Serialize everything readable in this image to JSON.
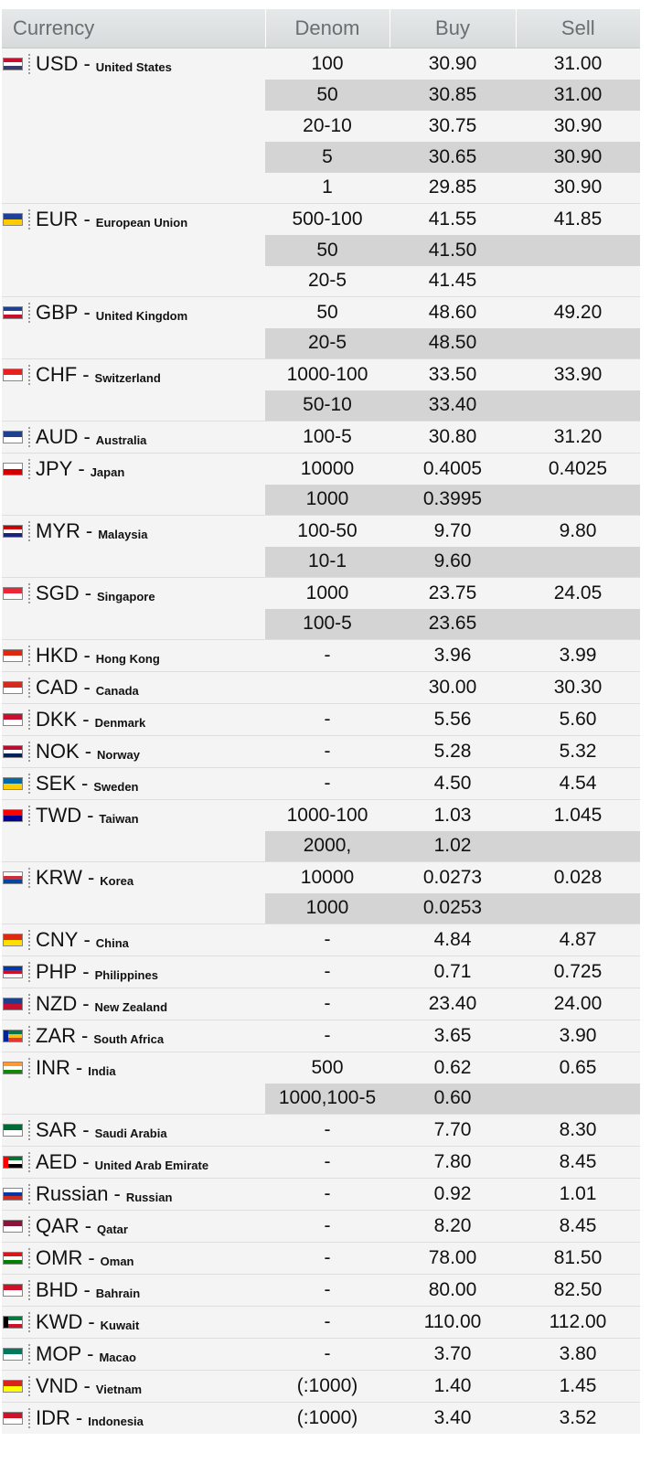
{
  "headers": {
    "currency": "Currency",
    "denom": "Denom",
    "buy": "Buy",
    "sell": "Sell"
  },
  "currencies": [
    {
      "code": "USD",
      "country": "United States",
      "flag": "us-flag",
      "colors": [
        "#c8102e",
        "#ffffff",
        "#3c3b6e"
      ],
      "rows": [
        {
          "denom": "100",
          "buy": "30.90",
          "sell": "31.00"
        },
        {
          "denom": "50",
          "buy": "30.85",
          "sell": "31.00"
        },
        {
          "denom": "20-10",
          "buy": "30.75",
          "sell": "30.90"
        },
        {
          "denom": "5",
          "buy": "30.65",
          "sell": "30.90"
        },
        {
          "denom": "1",
          "buy": "29.85",
          "sell": "30.90"
        }
      ]
    },
    {
      "code": "EUR",
      "country": "European Union",
      "flag": "eu-flag",
      "colors": [
        "#1f3f9f",
        "#ffcc00"
      ],
      "rows": [
        {
          "denom": "500-100",
          "buy": "41.55",
          "sell": "41.85"
        },
        {
          "denom": "50",
          "buy": "41.50",
          "sell": ""
        },
        {
          "denom": "20-5",
          "buy": "41.45",
          "sell": ""
        }
      ]
    },
    {
      "code": "GBP",
      "country": "United Kingdom",
      "flag": "uk-flag",
      "colors": [
        "#1f3f8f",
        "#ffffff",
        "#c8102e"
      ],
      "rows": [
        {
          "denom": "50",
          "buy": "48.60",
          "sell": "49.20"
        },
        {
          "denom": "20-5",
          "buy": "48.50",
          "sell": ""
        }
      ]
    },
    {
      "code": "CHF",
      "country": "Switzerland",
      "flag": "swiss-flag",
      "colors": [
        "#e8201e",
        "#ffffff"
      ],
      "rows": [
        {
          "denom": "1000-100",
          "buy": "33.50",
          "sell": "33.90"
        },
        {
          "denom": "50-10",
          "buy": "33.40",
          "sell": ""
        }
      ]
    },
    {
      "code": "AUD",
      "country": "Australia",
      "flag": "au-flag",
      "colors": [
        "#1f3f8f",
        "#ffffff"
      ],
      "rows": [
        {
          "denom": "100-5",
          "buy": "30.80",
          "sell": "31.20"
        }
      ]
    },
    {
      "code": "JPY",
      "country": "Japan",
      "flag": "jp-flag",
      "colors": [
        "#ffffff",
        "#d40000"
      ],
      "rows": [
        {
          "denom": "10000",
          "buy": "0.4005",
          "sell": "0.4025"
        },
        {
          "denom": "1000",
          "buy": "0.3995",
          "sell": ""
        }
      ]
    },
    {
      "code": "MYR",
      "country": "Malaysia",
      "flag": "my-flag",
      "colors": [
        "#cc0000",
        "#ffffff",
        "#1a237e"
      ],
      "rows": [
        {
          "denom": "100-50",
          "buy": "9.70",
          "sell": "9.80"
        },
        {
          "denom": "10-1",
          "buy": "9.60",
          "sell": ""
        }
      ]
    },
    {
      "code": "SGD",
      "country": "Singapore",
      "flag": "sg-flag",
      "colors": [
        "#ee2536",
        "#ffffff"
      ],
      "rows": [
        {
          "denom": "1000",
          "buy": "23.75",
          "sell": "24.05"
        },
        {
          "denom": "100-5",
          "buy": "23.65",
          "sell": ""
        }
      ]
    },
    {
      "code": "HKD",
      "country": "Hong Kong",
      "flag": "hk-flag",
      "colors": [
        "#de2910",
        "#ffffff"
      ],
      "rows": [
        {
          "denom": "-",
          "buy": "3.96",
          "sell": "3.99"
        }
      ]
    },
    {
      "code": "CAD",
      "country": "Canada",
      "flag": "ca-flag",
      "colors": [
        "#d52b1e",
        "#ffffff"
      ],
      "rows": [
        {
          "denom": "",
          "buy": "30.00",
          "sell": "30.30"
        }
      ]
    },
    {
      "code": "DKK",
      "country": "Denmark",
      "flag": "dk-flag",
      "colors": [
        "#c8102e",
        "#ffffff"
      ],
      "rows": [
        {
          "denom": "-",
          "buy": "5.56",
          "sell": "5.60"
        }
      ]
    },
    {
      "code": "NOK",
      "country": "Norway",
      "flag": "no-flag",
      "colors": [
        "#ba0c2f",
        "#ffffff",
        "#00205b"
      ],
      "rows": [
        {
          "denom": "-",
          "buy": "5.28",
          "sell": "5.32"
        }
      ]
    },
    {
      "code": "SEK",
      "country": "Sweden",
      "flag": "se-flag",
      "colors": [
        "#006aa7",
        "#fecc00"
      ],
      "rows": [
        {
          "denom": "-",
          "buy": "4.50",
          "sell": "4.54"
        }
      ]
    },
    {
      "code": "TWD",
      "country": "Taiwan",
      "flag": "tw-flag",
      "colors": [
        "#fe0000",
        "#000095"
      ],
      "rows": [
        {
          "denom": "1000-100",
          "buy": "1.03",
          "sell": "1.045"
        },
        {
          "denom": "2000,",
          "buy": "1.02",
          "sell": ""
        }
      ]
    },
    {
      "code": "KRW",
      "country": "Korea",
      "flag": "kr-flag",
      "colors": [
        "#ffffff",
        "#cd2e3a",
        "#0047a0"
      ],
      "rows": [
        {
          "denom": "10000",
          "buy": "0.0273",
          "sell": "0.028"
        },
        {
          "denom": "1000",
          "buy": "0.0253",
          "sell": ""
        }
      ]
    },
    {
      "code": "CNY",
      "country": "China",
      "flag": "cn-flag",
      "colors": [
        "#de2910",
        "#ffde00"
      ],
      "rows": [
        {
          "denom": "-",
          "buy": "4.84",
          "sell": "4.87"
        }
      ]
    },
    {
      "code": "PHP",
      "country": "Philippines",
      "flag": "ph-flag",
      "colors": [
        "#0038a8",
        "#ce1126",
        "#ffffff"
      ],
      "rows": [
        {
          "denom": "-",
          "buy": "0.71",
          "sell": "0.725"
        }
      ]
    },
    {
      "code": "NZD",
      "country": "New Zealand",
      "flag": "nz-flag",
      "colors": [
        "#1f3f8f",
        "#c8102e"
      ],
      "rows": [
        {
          "denom": "-",
          "buy": "23.40",
          "sell": "24.00"
        }
      ]
    },
    {
      "code": "ZAR",
      "country": "South Africa",
      "flag": "za-flag",
      "colors": [
        "#007749",
        "#ffb81c",
        "#de3831",
        "#002395"
      ],
      "rows": [
        {
          "denom": "-",
          "buy": "3.65",
          "sell": "3.90"
        }
      ]
    },
    {
      "code": "INR",
      "country": "India",
      "flag": "in-flag",
      "colors": [
        "#ff9933",
        "#ffffff",
        "#138808"
      ],
      "rows": [
        {
          "denom": "500",
          "buy": "0.62",
          "sell": "0.65"
        },
        {
          "denom": "1000,100-5",
          "buy": "0.60",
          "sell": ""
        }
      ]
    },
    {
      "code": "SAR",
      "country": "Saudi Arabia",
      "flag": "sa-flag",
      "colors": [
        "#006c35",
        "#ffffff"
      ],
      "rows": [
        {
          "denom": "-",
          "buy": "7.70",
          "sell": "8.30"
        }
      ]
    },
    {
      "code": "AED",
      "country": "United Arab Emirate",
      "flag": "ae-flag",
      "colors": [
        "#00732f",
        "#ffffff",
        "#000000",
        "#ff0000"
      ],
      "rows": [
        {
          "denom": "-",
          "buy": "7.80",
          "sell": "8.45"
        }
      ]
    },
    {
      "code": "Russian",
      "country": "Russian",
      "flag": "ru-flag",
      "colors": [
        "#ffffff",
        "#0039a6",
        "#d52b1e"
      ],
      "rows": [
        {
          "denom": "-",
          "buy": "0.92",
          "sell": "1.01"
        }
      ]
    },
    {
      "code": "QAR",
      "country": "Qatar",
      "flag": "qa-flag",
      "colors": [
        "#8a1538",
        "#ffffff"
      ],
      "rows": [
        {
          "denom": "-",
          "buy": "8.20",
          "sell": "8.45"
        }
      ]
    },
    {
      "code": "OMR",
      "country": "Oman",
      "flag": "om-flag",
      "colors": [
        "#db161b",
        "#ffffff",
        "#008000"
      ],
      "rows": [
        {
          "denom": "-",
          "buy": "78.00",
          "sell": "81.50"
        }
      ]
    },
    {
      "code": "BHD",
      "country": "Bahrain",
      "flag": "bh-flag",
      "colors": [
        "#ce1126",
        "#ffffff"
      ],
      "rows": [
        {
          "denom": "-",
          "buy": "80.00",
          "sell": "82.50"
        }
      ]
    },
    {
      "code": "KWD",
      "country": "Kuwait",
      "flag": "kw-flag",
      "colors": [
        "#007a3d",
        "#ffffff",
        "#ce1126",
        "#000000"
      ],
      "rows": [
        {
          "denom": "-",
          "buy": "110.00",
          "sell": "112.00"
        }
      ]
    },
    {
      "code": "MOP",
      "country": "Macao",
      "flag": "mo-flag",
      "colors": [
        "#00785e",
        "#ffffff"
      ],
      "rows": [
        {
          "denom": "-",
          "buy": "3.70",
          "sell": "3.80"
        }
      ]
    },
    {
      "code": "VND",
      "country": "Vietnam",
      "flag": "vn-flag",
      "colors": [
        "#da251d",
        "#ffff00"
      ],
      "rows": [
        {
          "denom": "(:1000)",
          "buy": "1.40",
          "sell": "1.45"
        }
      ]
    },
    {
      "code": "IDR",
      "country": "Indonesia",
      "flag": "id-flag",
      "colors": [
        "#ce1126",
        "#ffffff"
      ],
      "rows": [
        {
          "denom": "(:1000)",
          "buy": "3.40",
          "sell": "3.52"
        }
      ]
    }
  ]
}
